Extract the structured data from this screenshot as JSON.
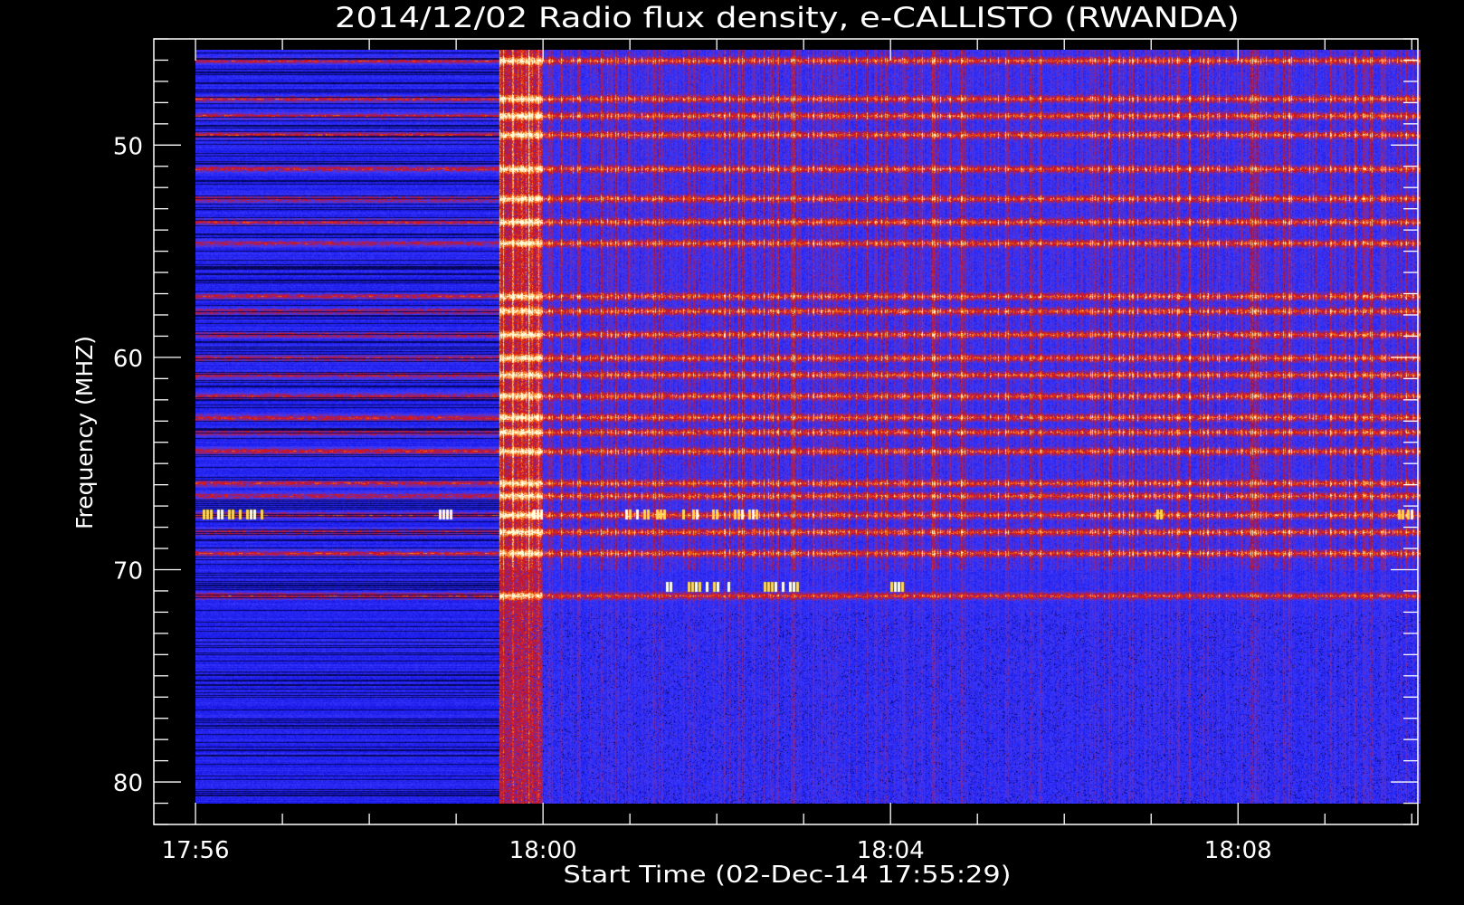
{
  "chart_data": {
    "type": "heatmap",
    "title": "2014/12/02  Radio flux density, e-CALLISTO (RWANDA)",
    "xlabel": "Start Time (02-Dec-14 17:55:29)",
    "ylabel": "Frequency (MHZ)",
    "x_range_minutes": [
      -0.48,
      14.07
    ],
    "x_ticks": [
      {
        "label": "17:56",
        "minute": 0
      },
      {
        "label": "18:00",
        "minute": 4
      },
      {
        "label": "18:04",
        "minute": 8
      },
      {
        "label": "18:08",
        "minute": 12
      }
    ],
    "x_minor_step_minutes": 1,
    "y_range_mhz": [
      45.0,
      82.0
    ],
    "y_inverted": true,
    "y_ticks": [
      50,
      60,
      70,
      80
    ],
    "y_minor_step_mhz": 1,
    "data_extent": {
      "time_start_minute": 0,
      "time_end_minute": 14.1,
      "freq_low_mhz": 45.5,
      "freq_high_mhz": 81.0,
      "receiver_change_minute": 3.5,
      "onset_enhancement_minutes": [
        3.5,
        4.0
      ]
    },
    "colormap": {
      "low": "#000000",
      "mid_low": "#1010e0",
      "mid": "#3a3aff",
      "mid_high": "#d81010",
      "high": "#ff8a1c",
      "peak": "#ffffe0"
    },
    "persistent_bands_mhz": [
      46.0,
      47.8,
      48.6,
      49.5,
      51.1,
      52.5,
      53.6,
      54.6,
      57.1,
      57.8,
      58.9,
      60.0,
      60.8,
      61.8,
      62.8,
      63.5,
      64.4,
      65.9,
      66.5,
      67.4,
      68.2,
      69.2,
      71.2
    ],
    "bright_features": [
      {
        "freq_mhz": 67.4,
        "minutes": [
          [
            0.08,
            0.78
          ],
          [
            2.8,
            2.95
          ],
          [
            3.88,
            3.98
          ],
          [
            4.9,
            5.2
          ],
          [
            5.3,
            5.45
          ],
          [
            5.6,
            5.65
          ],
          [
            5.72,
            5.77
          ],
          [
            5.95,
            6.0
          ],
          [
            6.2,
            6.5
          ],
          [
            10.85,
            10.9
          ],
          [
            11.06,
            11.14
          ],
          [
            13.8,
            13.9
          ],
          [
            13.95,
            14.05
          ]
        ]
      },
      {
        "freq_mhz": 70.8,
        "minutes": [
          [
            5.42,
            6.2
          ],
          [
            6.5,
            6.92
          ],
          [
            8.0,
            8.12
          ]
        ]
      }
    ]
  }
}
